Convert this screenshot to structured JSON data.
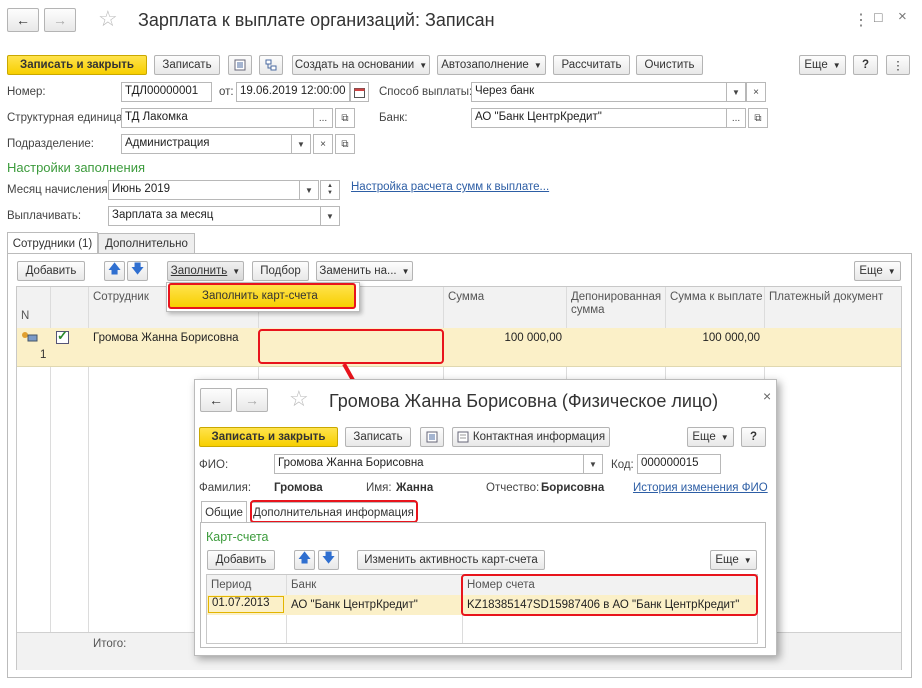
{
  "main": {
    "title": "Зарплата к выплате организаций: Записан",
    "toolbar": {
      "save_close": "Записать и закрыть",
      "save": "Записать",
      "create_based": "Создать на основании",
      "autofill": "Автозаполнение",
      "calculate": "Рассчитать",
      "clear": "Очистить",
      "more": "Еще",
      "help": "?"
    },
    "form": {
      "number_label": "Номер:",
      "number_value": "ТДЛ00000001",
      "date_label": "от:",
      "date_value": "19.06.2019 12:00:00",
      "payment_method_label": "Способ выплаты:",
      "payment_method_value": "Через банк",
      "structural_unit_label": "Структурная единица:",
      "structural_unit_value": "ТД Лакомка",
      "bank_label": "Банк:",
      "bank_value": "АО \"Банк ЦентрКредит\"",
      "department_label": "Подразделение:",
      "department_value": "Администрация",
      "settings_header": "Настройки заполнения",
      "month_label": "Месяц начисления:",
      "month_value": "Июнь 2019",
      "calc_settings_link": "Настройка расчета сумм к выплате...",
      "pay_label": "Выплачивать:",
      "pay_value": "Зарплата за месяц"
    },
    "tabs": [
      "Сотрудники (1)",
      "Дополнительно"
    ],
    "table_toolbar": {
      "add": "Добавить",
      "fill": "Заполнить",
      "select": "Подбор",
      "replace": "Заменить на...",
      "more": "Еще"
    },
    "dropdown_item": "Заполнить карт-счета",
    "columns": {
      "n": "N",
      "employee": "Сотрудник",
      "sum": "Сумма",
      "deposited": "Депонированная сумма",
      "sum_to_pay": "Сумма к выплате",
      "payment_doc": "Платежный документ"
    },
    "row": {
      "n": "1",
      "employee": "Громова Жанна Борисовна",
      "sum": "100 000,00",
      "sum_to_pay": "100 000,00"
    },
    "footer_total": "Итого:"
  },
  "popup": {
    "title": "Громова Жанна Борисовна (Физическое лицо)",
    "save_close": "Записать и закрыть",
    "save": "Записать",
    "contact_info": "Контактная информация",
    "more": "Еще",
    "help": "?",
    "fio_label": "ФИО:",
    "fio_value": "Громова Жанна Борисовна",
    "code_label": "Код:",
    "code_value": "000000015",
    "surname_label": "Фамилия:",
    "surname_value": "Громова",
    "name_label": "Имя:",
    "name_value": "Жанна",
    "patronymic_label": "Отчество:",
    "patronymic_value": "Борисовна",
    "history_link": "История изменения ФИО",
    "tabs": [
      "Общие",
      "Дополнительная информация"
    ],
    "cards_header": "Карт-счета",
    "add": "Добавить",
    "change_active": "Изменить активность карт-счета",
    "more2": "Еще",
    "columns": {
      "period": "Период",
      "bank": "Банк",
      "account": "Номер счета"
    },
    "row": {
      "period": "01.07.2013",
      "bank": "АО \"Банк ЦентрКредит\"",
      "account": "KZ18385147SD15987406 в АО \"Банк ЦентрКредит\""
    }
  },
  "colors": {
    "accent_yellow": "#f7cf00",
    "highlight_red": "#e8141c",
    "row_highlight": "#fbf0c8",
    "green_header": "#3c9b3c"
  }
}
